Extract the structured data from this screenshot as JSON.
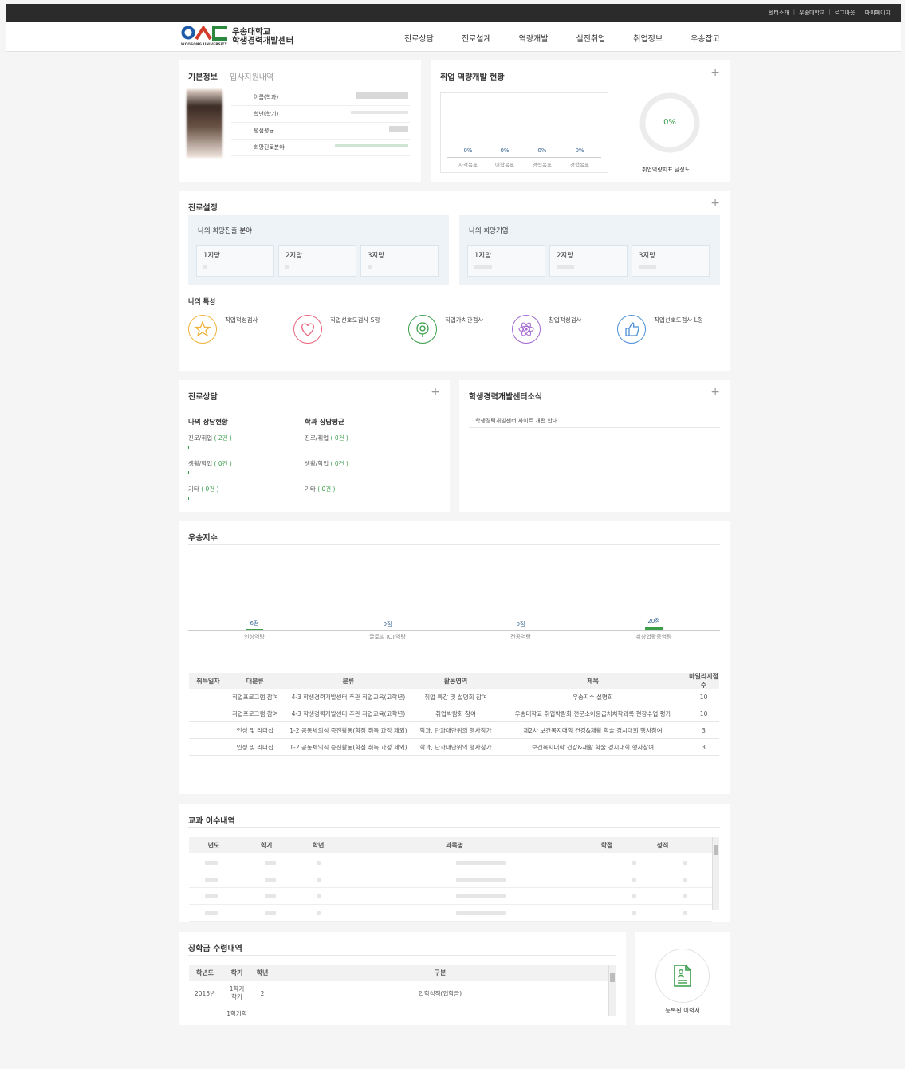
{
  "topbar": {
    "links": [
      "센터소개",
      "우송대학교",
      "로그아웃",
      "마이페이지"
    ]
  },
  "header": {
    "logo_subtext": "WOOSONG UNIVERSITY",
    "brand_line1": "우송대학교",
    "brand_line2": "학생경력개발센터",
    "nav": [
      "진로상담",
      "진로설계",
      "역량개발",
      "실전취업",
      "취업정보",
      "우송잡고"
    ]
  },
  "basic_info": {
    "tab_active": "기본정보",
    "tab_inactive": "입사지원내역",
    "fields": [
      "이름(학과)",
      "학년(학기)",
      "평점평균",
      "희망진로분야"
    ]
  },
  "competency": {
    "title": "취업 역량개발 현황",
    "bars": [
      {
        "label": "자격목표",
        "value": "0%"
      },
      {
        "label": "어학목표",
        "value": "0%"
      },
      {
        "label": "경력목표",
        "value": "0%"
      },
      {
        "label": "경험목표",
        "value": "0%"
      }
    ],
    "gauge_value": "0%",
    "gauge_progress": 0,
    "gauge_label": "취업역량지표 달성도"
  },
  "career_setting": {
    "title": "진로설정",
    "field_title": "나의 희망진출 분야",
    "company_title": "나의 희망기업",
    "choices": [
      "1지망",
      "2지망",
      "3지망"
    ],
    "traits_title": "나의 특성",
    "traits": [
      {
        "label": "직업적성검사",
        "icon": "star-icon",
        "color": "#f0b23a"
      },
      {
        "label": "직업선호도검사 S형",
        "icon": "heart-icon",
        "color": "#e9667e"
      },
      {
        "label": "직업가치관검사",
        "icon": "target-icon",
        "color": "#3a9e4a"
      },
      {
        "label": "창업적성검사",
        "icon": "atom-icon",
        "color": "#a46ad0"
      },
      {
        "label": "직업선호도검사 L형",
        "icon": "thumbs-up-icon",
        "color": "#4a8fd6"
      }
    ]
  },
  "counseling": {
    "title": "진로상담",
    "my_title": "나의 상담현황",
    "avg_title": "학과 상담평균",
    "my_items": [
      {
        "label": "진로/취업",
        "count": "( 2건 )"
      },
      {
        "label": "생활/학업",
        "count": "( 0건 )"
      },
      {
        "label": "기타",
        "count": "( 0건 )"
      }
    ],
    "avg_items": [
      {
        "label": "진로/취업",
        "count": "( 0건 )"
      },
      {
        "label": "생활/학업",
        "count": "( 0건 )"
      },
      {
        "label": "기타",
        "count": "( 0건 )"
      }
    ]
  },
  "news": {
    "title": "학생경력개발센터소식",
    "items": [
      "학생경력개발센터 사이트 개편 안내"
    ]
  },
  "index": {
    "title": "우송지수",
    "chart_data": {
      "type": "bar",
      "categories": [
        "인성역량",
        "글로벌 ICT역량",
        "전공역량",
        "취창업활동역량"
      ],
      "values": [
        6,
        0,
        0,
        20
      ],
      "value_labels": [
        "6점",
        "0점",
        "0점",
        "20점"
      ],
      "ylim": [
        0,
        20
      ]
    },
    "table_headers": [
      "취득일자",
      "대분류",
      "분류",
      "활동영역",
      "제목",
      "마일리지점수"
    ],
    "rows": [
      [
        "",
        "취업프로그램 참여",
        "4-3 학생경력개발센터 주관 취업교육(고학년)",
        "취업 특강 및 설명회 참여",
        "우송지수 설명회",
        "10"
      ],
      [
        "",
        "취업프로그램 참여",
        "4-3 학생경력개발센터 주관 취업교육(고학년)",
        "취업박람회 참여",
        "우송대학교 취업박람회 전문소아응급처치학과록 현장수업 평가",
        "10"
      ],
      [
        "",
        "인성 및 리더십",
        "1-2 공동체의식 증진활동(학점 취득 과정 제외)",
        "학과, 단과대단위의 행사참가",
        "제2차 보건복지대학 건강&재활 학술 경시대회 행사참여",
        "3"
      ],
      [
        "",
        "인성 및 리더십",
        "1-2 공동체의식 증진활동(학점 취득 과정 제외)",
        "학과, 단과대단위의 행사참가",
        "보건복지대학 건강&재활 학술 경시대회 행사참여",
        "3"
      ]
    ]
  },
  "courses": {
    "title": "교과 이수내역",
    "headers": [
      "년도",
      "학기",
      "학년",
      "과목명",
      "학점",
      "성적"
    ]
  },
  "scholarship": {
    "title": "장학금 수령내역",
    "headers": [
      "학년도",
      "학기",
      "학년",
      "구분"
    ],
    "rows": [
      {
        "year": "2015년",
        "term": "1학기학기",
        "grade": "2",
        "type": "입학성적(입학금)"
      },
      {
        "year": "",
        "term": "1학기학",
        "grade": "",
        "type": ""
      }
    ]
  },
  "resume": {
    "label": "등록된 이력서",
    "icon": "document-icon"
  }
}
